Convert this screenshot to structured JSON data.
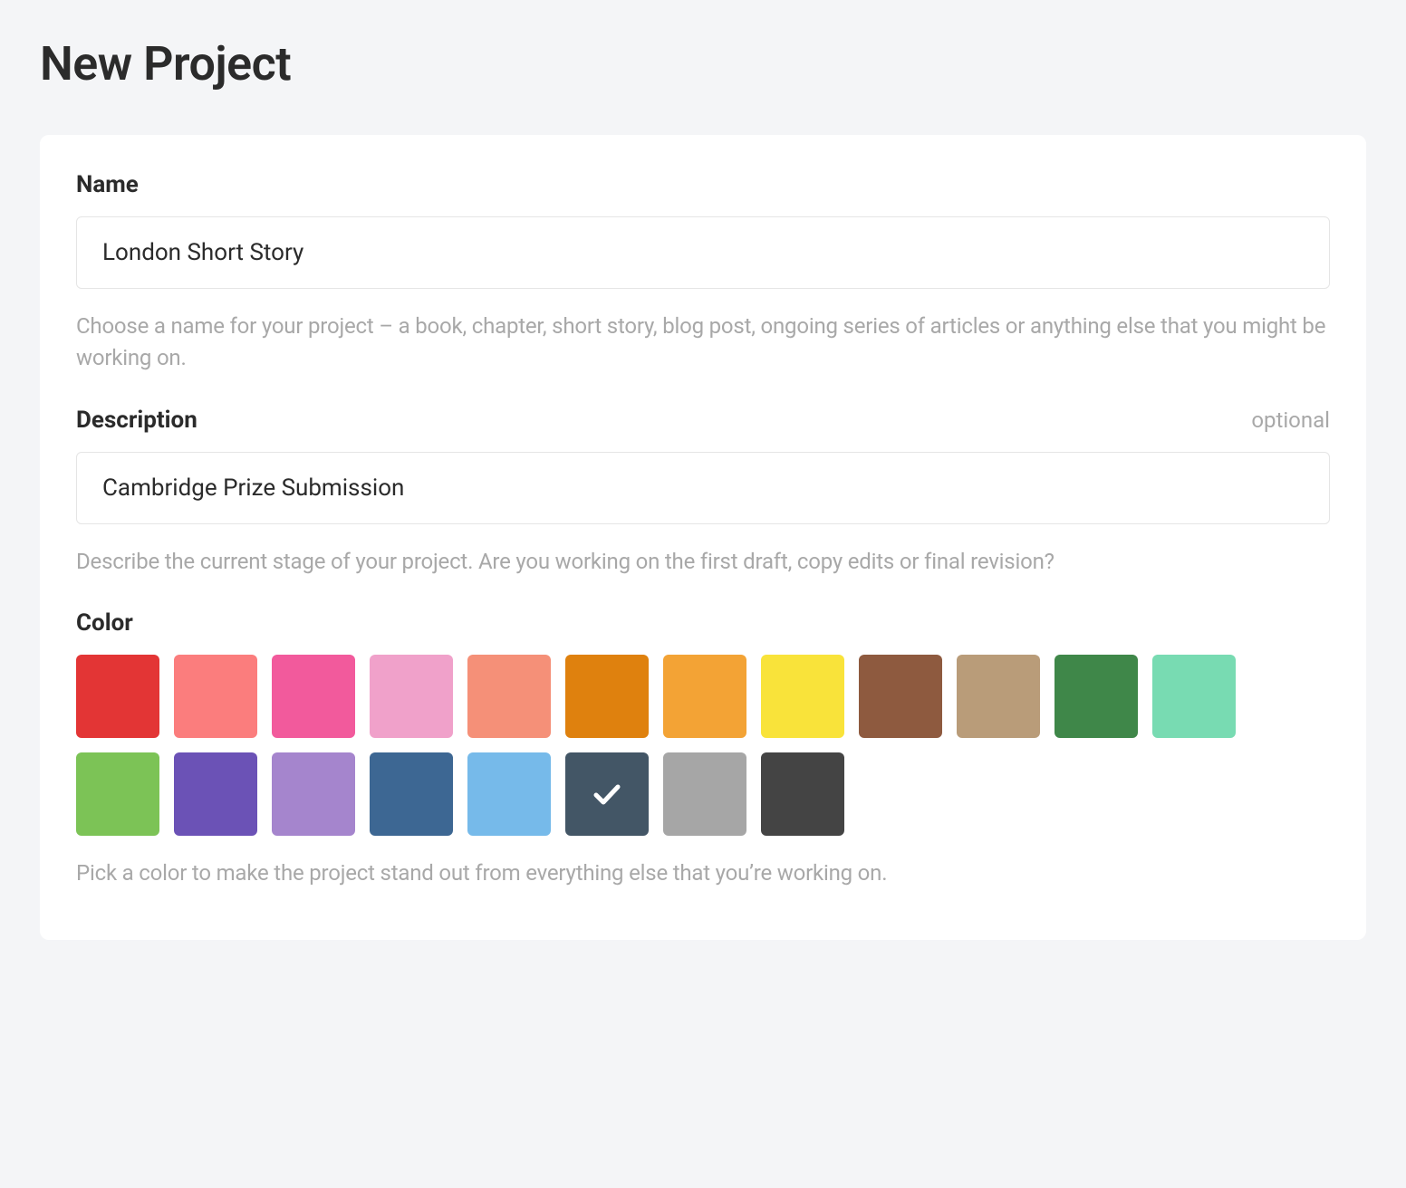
{
  "page": {
    "title": "New Project"
  },
  "form": {
    "name": {
      "label": "Name",
      "value": "London Short Story",
      "help": "Choose a name for your project – a book, chapter, short story, blog post, ongoing series of articles or anything else that you might be working on."
    },
    "description": {
      "label": "Description",
      "optional_tag": "optional",
      "value": "Cambridge Prize Submission",
      "help": "Describe the current stage of your project. Are you working on the first draft, copy edits or final revision?"
    },
    "color": {
      "label": "Color",
      "help": "Pick a color to make the project stand out from everything else that you’re working on.",
      "selected_index": 17,
      "swatches": [
        {
          "name": "red",
          "hex": "#e33535"
        },
        {
          "name": "salmon",
          "hex": "#fb7d7d"
        },
        {
          "name": "pink",
          "hex": "#f25a9c"
        },
        {
          "name": "light-pink",
          "hex": "#f0a1ca"
        },
        {
          "name": "coral",
          "hex": "#f59078"
        },
        {
          "name": "dark-orange",
          "hex": "#df810e"
        },
        {
          "name": "orange",
          "hex": "#f3a335"
        },
        {
          "name": "yellow",
          "hex": "#f9e33a"
        },
        {
          "name": "brown",
          "hex": "#8e5a3f"
        },
        {
          "name": "tan",
          "hex": "#b99c79"
        },
        {
          "name": "dark-green",
          "hex": "#3f8749"
        },
        {
          "name": "mint",
          "hex": "#78dbb2"
        },
        {
          "name": "green",
          "hex": "#7cc356"
        },
        {
          "name": "purple",
          "hex": "#6b52b6"
        },
        {
          "name": "light-purple",
          "hex": "#a585cd"
        },
        {
          "name": "steel-blue",
          "hex": "#3d6793"
        },
        {
          "name": "light-blue",
          "hex": "#76baea"
        },
        {
          "name": "slate",
          "hex": "#435666"
        },
        {
          "name": "gray",
          "hex": "#a6a6a6"
        },
        {
          "name": "charcoal",
          "hex": "#444444"
        }
      ]
    }
  }
}
